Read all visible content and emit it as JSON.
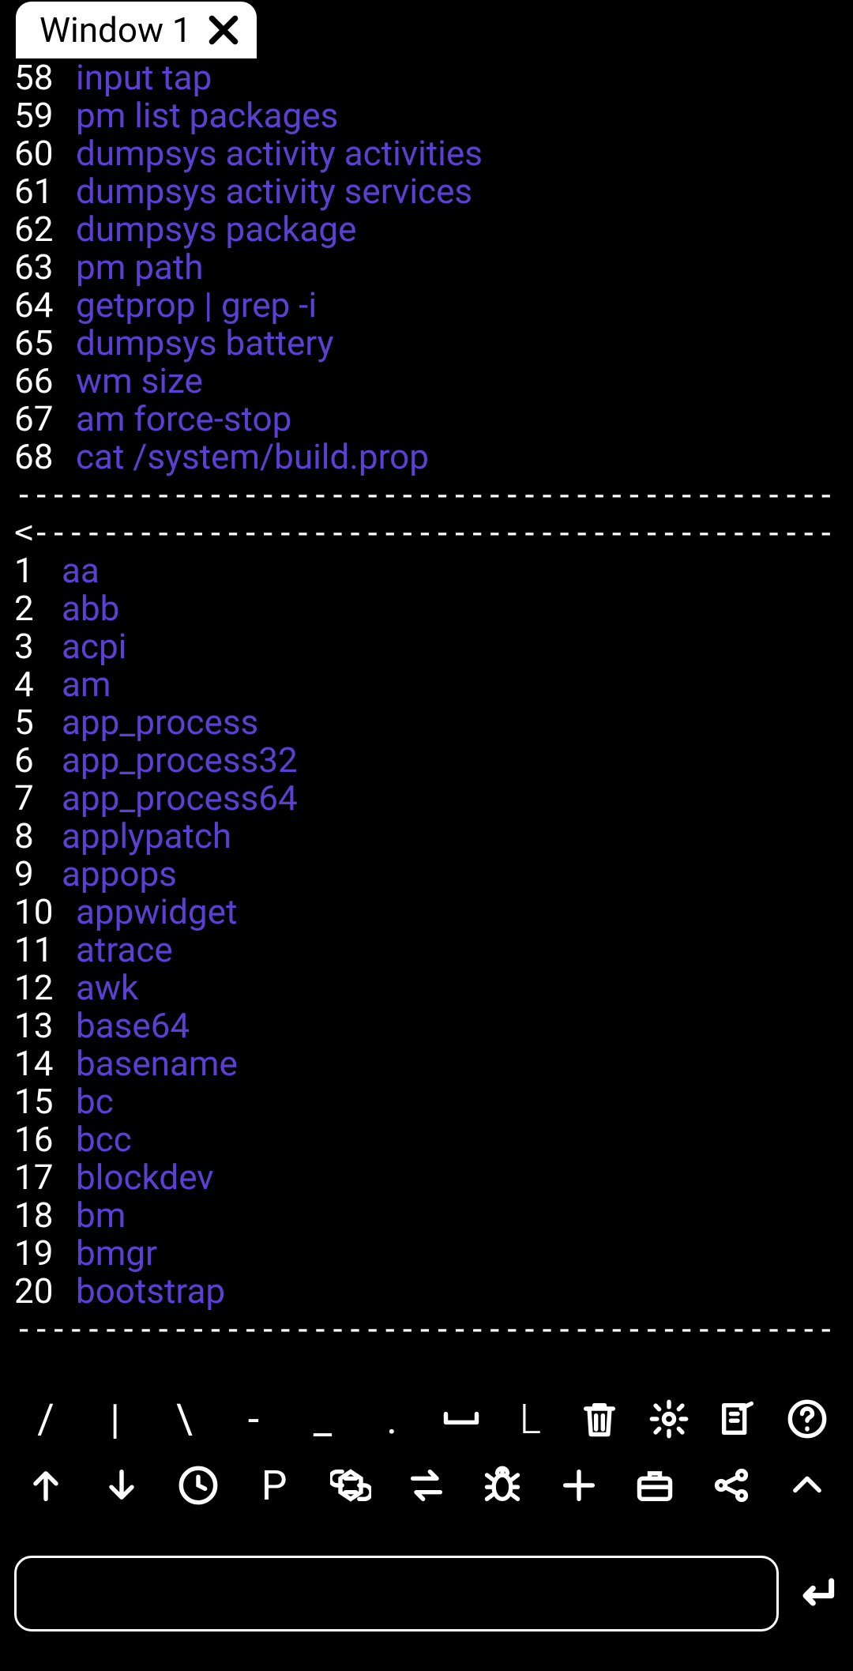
{
  "tab": {
    "title": "Window 1"
  },
  "list1": [
    {
      "n": "58",
      "cmd": "input tap"
    },
    {
      "n": "59",
      "cmd": "pm list packages"
    },
    {
      "n": "60",
      "cmd": "dumpsys activity activities"
    },
    {
      "n": "61",
      "cmd": "dumpsys activity services"
    },
    {
      "n": "62",
      "cmd": "dumpsys package"
    },
    {
      "n": "63",
      "cmd": "pm path"
    },
    {
      "n": "64",
      "cmd": "getprop | grep -i"
    },
    {
      "n": "65",
      "cmd": "dumpsys battery"
    },
    {
      "n": "66",
      "cmd": "wm size"
    },
    {
      "n": "67",
      "cmd": "am force-stop"
    },
    {
      "n": "68",
      "cmd": "cat /system/build.prop"
    }
  ],
  "div1": "------------------------------------------------------->",
  "div2": "<-------------------------------------------------------",
  "list2": [
    {
      "n": "1",
      "cmd": "aa"
    },
    {
      "n": "2",
      "cmd": "abb"
    },
    {
      "n": "3",
      "cmd": "acpi"
    },
    {
      "n": "4",
      "cmd": "am"
    },
    {
      "n": "5",
      "cmd": "app_process"
    },
    {
      "n": "6",
      "cmd": "app_process32"
    },
    {
      "n": "7",
      "cmd": "app_process64"
    },
    {
      "n": "8",
      "cmd": "applypatch"
    },
    {
      "n": "9",
      "cmd": "appops"
    },
    {
      "n": "10",
      "cmd": "appwidget"
    },
    {
      "n": "11",
      "cmd": "atrace"
    },
    {
      "n": "12",
      "cmd": "awk"
    },
    {
      "n": "13",
      "cmd": "base64"
    },
    {
      "n": "14",
      "cmd": "basename"
    },
    {
      "n": "15",
      "cmd": "bc"
    },
    {
      "n": "16",
      "cmd": "bcc"
    },
    {
      "n": "17",
      "cmd": "blockdev"
    },
    {
      "n": "18",
      "cmd": "bm"
    },
    {
      "n": "19",
      "cmd": "bmgr"
    },
    {
      "n": "20",
      "cmd": "bootstrap"
    }
  ],
  "div3": "------------------------------------------------------->",
  "toolbar": {
    "row1": [
      "/",
      "|",
      "\\",
      "-",
      "_",
      ".",
      "space",
      "L",
      "trash",
      "gear",
      "edit",
      "help"
    ],
    "row2": [
      "up",
      "down",
      "clock",
      "P",
      "chain",
      "swap",
      "bug",
      "plus",
      "briefcase",
      "share",
      "chevron-up"
    ]
  },
  "input": {
    "value": ""
  }
}
